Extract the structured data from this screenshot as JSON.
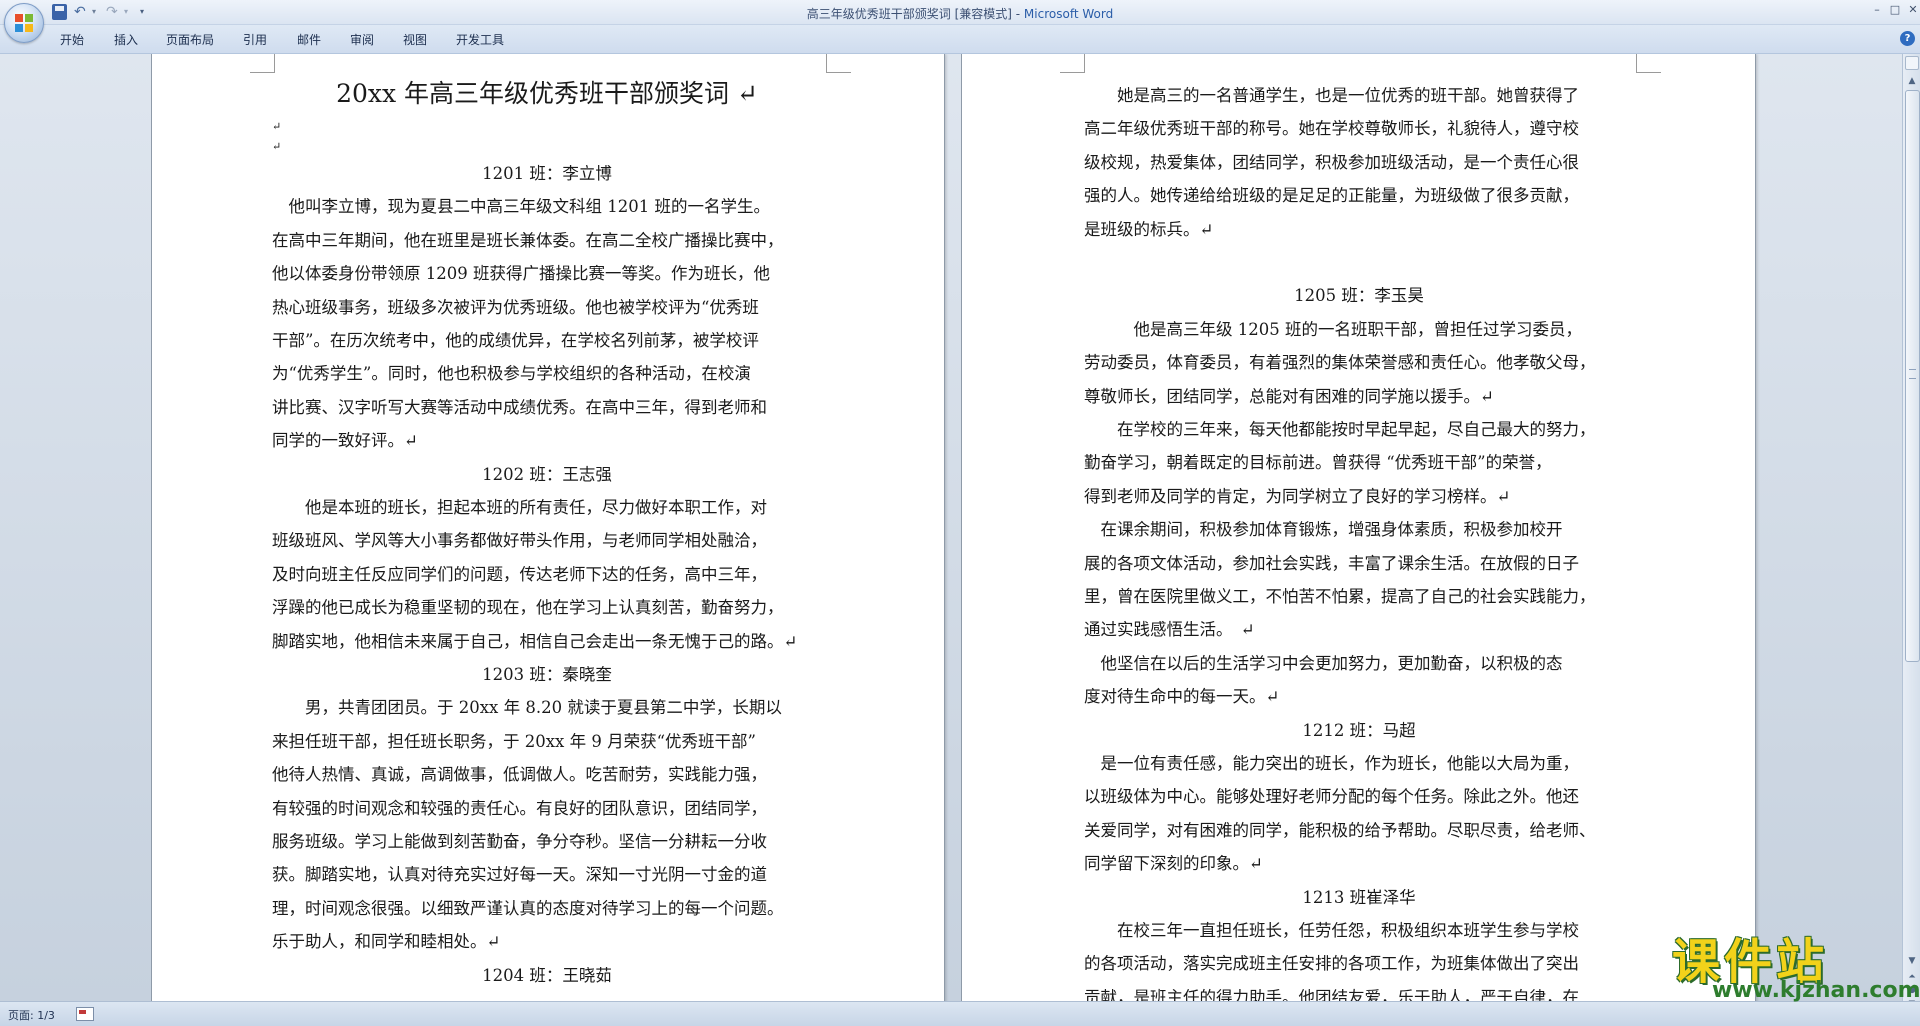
{
  "window": {
    "title": "高三年级优秀班干部颁奖词 [兼容模式] - ",
    "app_name": "Microsoft Word"
  },
  "quick_access": {
    "save_icon": "save-icon",
    "undo_icon": "undo-icon",
    "redo_icon": "redo-icon"
  },
  "ribbon": {
    "tabs": [
      "开始",
      "插入",
      "页面布局",
      "引用",
      "邮件",
      "审阅",
      "视图",
      "开发工具"
    ]
  },
  "document": {
    "page1": {
      "title": "20xx 年高三年级优秀班干部颁奖词",
      "lines": [
        {
          "type": "mark",
          "text": "↵"
        },
        {
          "type": "mark",
          "text": "↵"
        },
        {
          "type": "heading",
          "text": "1201 班：李立博"
        },
        {
          "type": "body",
          "text": "　他叫李立博，现为夏县二中高三年级文科组 1201 班的一名学生。"
        },
        {
          "type": "body",
          "text": "在高中三年期间，他在班里是班长兼体委。在高二全校广播操比赛中，"
        },
        {
          "type": "body",
          "text": "他以体委身份带领原 1209 班获得广播操比赛一等奖。作为班长，他"
        },
        {
          "type": "body",
          "text": "热心班级事务，班级多次被评为优秀班级。他也被学校评为“优秀班"
        },
        {
          "type": "body",
          "text": "干部”。在历次统考中，他的成绩优异，在学校名列前茅，被学校评"
        },
        {
          "type": "body",
          "text": "为“优秀学生”。同时，他也积极参与学校组织的各种活动，在校演"
        },
        {
          "type": "body",
          "text": "讲比赛、汉字听写大赛等活动中成绩优秀。在高中三年，得到老师和"
        },
        {
          "type": "body",
          "text": "同学的一致好评。↵"
        },
        {
          "type": "heading",
          "text": "1202 班：王志强"
        },
        {
          "type": "body",
          "text": "　　他是本班的班长，担起本班的所有责任，尽力做好本职工作，对"
        },
        {
          "type": "body",
          "text": "班级班风、学风等大小事务都做好带头作用，与老师同学相处融洽，"
        },
        {
          "type": "body",
          "text": "及时向班主任反应同学们的问题，传达老师下达的任务，高中三年，"
        },
        {
          "type": "body",
          "text": "浮躁的他已成长为稳重坚韧的现在，他在学习上认真刻苦，勤奋努力，"
        },
        {
          "type": "body",
          "text": "脚踏实地，他相信未来属于自己，相信自己会走出一条无愧于己的路。↵"
        },
        {
          "type": "heading",
          "text": "1203 班：秦晓奎"
        },
        {
          "type": "body",
          "text": "　　男，共青团团员。于 20xx 年 8.20 就读于夏县第二中学，长期以"
        },
        {
          "type": "body",
          "text": "来担任班干部，担任班长职务，于 20xx 年 9 月荣获“优秀班干部”"
        },
        {
          "type": "body",
          "text": "他待人热情、真诚，高调做事，低调做人。吃苦耐劳，实践能力强，"
        },
        {
          "type": "body",
          "text": "有较强的时间观念和较强的责任心。有良好的团队意识，团结同学，"
        },
        {
          "type": "body",
          "text": "服务班级。学习上能做到刻苦勤奋，争分夺秒。坚信一分耕耘一分收"
        },
        {
          "type": "body",
          "text": "获。脚踏实地，认真对待充实过好每一天。深知一寸光阴一寸金的道"
        },
        {
          "type": "body",
          "text": "理，时间观念很强。以细致严谨认真的态度对待学习上的每一个问题。"
        },
        {
          "type": "body",
          "text": "乐于助人，和同学和睦相处。↵"
        },
        {
          "type": "heading",
          "text": "1204 班：王晓茹"
        }
      ]
    },
    "page2": {
      "lines": [
        {
          "type": "body",
          "text": "　　她是高三的一名普通学生，也是一位优秀的班干部。她曾获得了"
        },
        {
          "type": "body",
          "text": "高二年级优秀班干部的称号。她在学校尊敬师长，礼貌待人，遵守校"
        },
        {
          "type": "body",
          "text": "级校规，热爱集体，团结同学，积极参加班级活动，是一个责任心很"
        },
        {
          "type": "body",
          "text": "强的人。她传递给给班级的是足足的正能量，为班级做了很多贡献，"
        },
        {
          "type": "body",
          "text": "是班级的标兵。↵"
        },
        {
          "type": "blank",
          "text": ""
        },
        {
          "type": "heading",
          "text": "1205 班：李玉昊"
        },
        {
          "type": "body",
          "text": "　　　他是高三年级 1205 班的一名班职干部，曾担任过学习委员，"
        },
        {
          "type": "body",
          "text": "劳动委员，体育委员，有着强烈的集体荣誉感和责任心。他孝敬父母，"
        },
        {
          "type": "body",
          "text": "尊敬师长，团结同学，总能对有困难的同学施以援手。↵"
        },
        {
          "type": "body",
          "text": "　　在学校的三年来，每天他都能按时早起早起，尽自己最大的努力，"
        },
        {
          "type": "body",
          "text": "勤奋学习，朝着既定的目标前进。曾获得 “优秀班干部”的荣誉，"
        },
        {
          "type": "body",
          "text": "得到老师及同学的肯定，为同学树立了良好的学习榜样。↵"
        },
        {
          "type": "body",
          "text": "　在课余期间，积极参加体育锻炼，增强身体素质，积极参加校开"
        },
        {
          "type": "body",
          "text": "展的各项文体活动，参加社会实践，丰富了课余生活。在放假的日子"
        },
        {
          "type": "body",
          "text": "里，曾在医院里做义工，不怕苦不怕累，提高了自己的社会实践能力，"
        },
        {
          "type": "body",
          "text": "通过实践感悟生活。　↵"
        },
        {
          "type": "body",
          "text": "　他坚信在以后的生活学习中会更加努力，更加勤奋，以积极的态"
        },
        {
          "type": "body",
          "text": "度对待生命中的每一天。↵"
        },
        {
          "type": "heading",
          "text": "1212 班：马超"
        },
        {
          "type": "body",
          "text": "　是一位有责任感，能力突出的班长，作为班长，他能以大局为重，"
        },
        {
          "type": "body",
          "text": "以班级体为中心。能够处理好老师分配的每个任务。除此之外。他还"
        },
        {
          "type": "body",
          "text": "关爱同学，对有困难的同学，能积极的给予帮助。尽职尽责，给老师、"
        },
        {
          "type": "body",
          "text": "同学留下深刻的印象。↵"
        },
        {
          "type": "heading",
          "text": "1213 班崔泽华"
        },
        {
          "type": "body",
          "text": "　　在校三年一直担任班长，任劳任怨，积极组织本班学生参与学校"
        },
        {
          "type": "body",
          "text": "的各项活动，落实完成班主任安排的各项工作，为班集体做出了突出"
        },
        {
          "type": "body",
          "text": "贡献，是班主任的得力助手。他团结友爱，乐于助人，严于自律，在"
        }
      ]
    }
  },
  "status": {
    "page_info": "页面: 1/3"
  },
  "watermark": {
    "brand": "课件站",
    "url": "www.kjzhan.com"
  }
}
